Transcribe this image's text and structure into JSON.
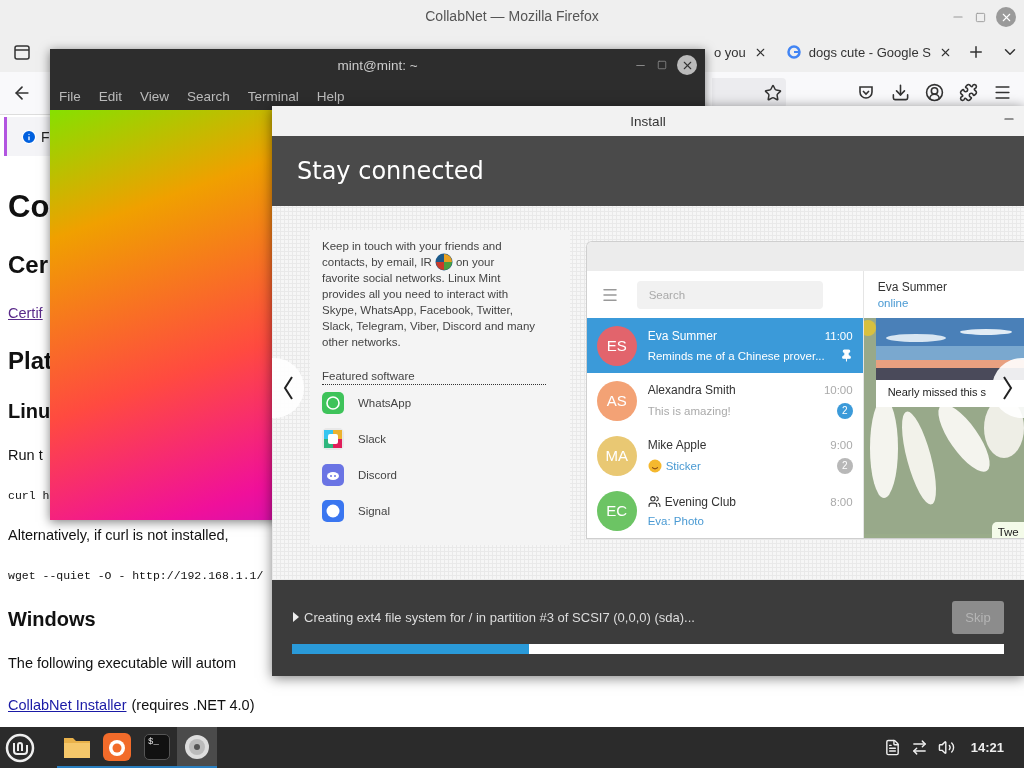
{
  "firefox": {
    "title": "CollabNet — Mozilla Firefox",
    "tabs": [
      {
        "label": "o you",
        "selected": false
      },
      {
        "label": "dogs cute - Google S",
        "selected": false
      }
    ],
    "notification": {
      "text": "F"
    },
    "page": [
      {
        "kind": "h1",
        "text": "Co"
      },
      {
        "kind": "h2",
        "text": "Cer"
      },
      {
        "kind": "link",
        "text": "Certif"
      },
      {
        "kind": "h2",
        "text": "Plat"
      },
      {
        "kind": "h3",
        "text": "Linu"
      },
      {
        "kind": "p",
        "text": "Run t"
      },
      {
        "kind": "code",
        "text": "curl h"
      },
      {
        "kind": "p",
        "text": "Alternatively, if curl is not installed,"
      },
      {
        "kind": "code",
        "text": "wget --quiet -O - http://192.168.1.1/"
      },
      {
        "kind": "h3",
        "text": "Windows"
      },
      {
        "kind": "p",
        "text": "The following executable will autom"
      },
      {
        "kind": "linkline",
        "link": "CollabNet Installer",
        "text": "(requires .NET 4.0)"
      }
    ]
  },
  "terminal": {
    "title": "mint@mint: ~",
    "menu": [
      "File",
      "Edit",
      "View",
      "Search",
      "Terminal",
      "Help"
    ]
  },
  "installer": {
    "title": "Install",
    "heading": "Stay connected",
    "description_first_line": "Keep in touch with your friends and",
    "description_second_line_start": "contacts, by email, IR",
    "description_second_line_end": "on your",
    "description_rest": "favorite social networks. Linux Mint provides all you need to interact with Skype, WhatsApp, Facebook, Twitter, Slack, Telegram, Viber, Discord and many other networks.",
    "featured_label": "Featured software",
    "featured": [
      {
        "name": "WhatsApp",
        "kind": "whatsapp"
      },
      {
        "name": "Slack",
        "kind": "slack"
      },
      {
        "name": "Discord",
        "kind": "discord"
      },
      {
        "name": "Signal",
        "kind": "signal"
      }
    ],
    "chat_app": {
      "search_placeholder": "Search",
      "chats": [
        {
          "initials": "ES",
          "name": "Eva Summer",
          "time": "11:00",
          "message": "Reminds me of a Chinese prover...",
          "kind": "text",
          "selected": true,
          "pinned": true,
          "group": false,
          "color": "#e2646c"
        },
        {
          "initials": "AS",
          "name": "Alexandra Smith",
          "time": "10:00",
          "message": "This is amazing!",
          "kind": "text",
          "selected": false,
          "pinned": false,
          "group": false,
          "badge": "2",
          "badge_muted": false,
          "color": "#f3a275"
        },
        {
          "initials": "MA",
          "name": "Mike Apple",
          "time": "9:00",
          "message": "Sticker",
          "kind": "sticker",
          "selected": false,
          "pinned": false,
          "group": false,
          "badge": "2",
          "badge_muted": true,
          "color": "#e9c873"
        },
        {
          "initials": "EC",
          "name": "Evening Club",
          "time": "8:00",
          "message": "Eva: Photo",
          "kind": "media",
          "selected": false,
          "pinned": false,
          "group": true,
          "color": "#6cc464"
        }
      ],
      "contact": {
        "name": "Eva Summer",
        "status": "online"
      },
      "photo_caption": "Nearly missed this s",
      "bubble": "Twe"
    },
    "status": {
      "text": "Creating ext4 file system for / in partition #3 of SCSI7 (0,0,0) (sda)...",
      "expanded": false
    },
    "skip": {
      "label": "Skip",
      "disabled": true
    },
    "progress": {
      "level": 0.333
    }
  },
  "taskbar": {
    "apps": [
      {
        "kind": "files",
        "running": true,
        "selected": false
      },
      {
        "kind": "browser",
        "running": true,
        "selected": false
      },
      {
        "kind": "terminal",
        "glyph": "$_",
        "running": true,
        "selected": false
      },
      {
        "kind": "disc",
        "running": true,
        "selected": true
      }
    ],
    "clock": "14:21"
  }
}
